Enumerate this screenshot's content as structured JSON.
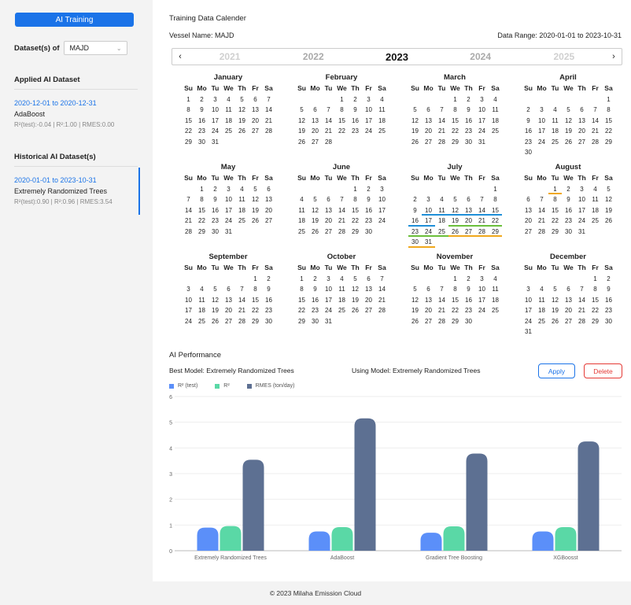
{
  "sidebar": {
    "ai_training_label": "AI Training",
    "dataset_label": "Dataset(s) of",
    "dataset_value": "MAJD",
    "applied_title": "Applied AI Dataset",
    "applied": {
      "range": "2020-12-01 to 2020-12-31",
      "model": "AdaBoost",
      "metrics": "R²(test):-0.04 | R²:1.00 | RMES:0.00"
    },
    "historical_title": "Historical AI Dataset(s)",
    "historical": {
      "range": "2020-01-01 to 2023-10-31",
      "model": "Extremely Randomized Trees",
      "metrics": "R²(test):0.90 | R²:0.96 | RMES:3.54"
    }
  },
  "main": {
    "title": "Training Data Calender",
    "vessel": "Vessel Name: MAJD",
    "data_range": "Data Range: 2020-01-01 to 2023-10-31"
  },
  "year_bar": {
    "prev": "‹",
    "next": "›",
    "years": [
      "2021",
      "2022",
      "2023",
      "2024",
      "2025"
    ],
    "active": "2023"
  },
  "weekday_labels": [
    "Su",
    "Mo",
    "Tu",
    "We",
    "Th",
    "Fr",
    "Sa"
  ],
  "calendar": [
    {
      "name": "January",
      "first": 0,
      "days": 31
    },
    {
      "name": "February",
      "first": 3,
      "days": 28
    },
    {
      "name": "March",
      "first": 3,
      "days": 31
    },
    {
      "name": "April",
      "first": 6,
      "days": 30
    },
    {
      "name": "May",
      "first": 1,
      "days": 31
    },
    {
      "name": "June",
      "first": 4,
      "days": 30
    },
    {
      "name": "July",
      "first": 6,
      "days": 31
    },
    {
      "name": "August",
      "first": 2,
      "days": 31
    },
    {
      "name": "September",
      "first": 5,
      "days": 30
    },
    {
      "name": "October",
      "first": 0,
      "days": 31
    },
    {
      "name": "November",
      "first": 3,
      "days": 30
    },
    {
      "name": "December",
      "first": 5,
      "days": 31
    }
  ],
  "highlights": {
    "July": {
      "10": "blue",
      "11": "blue",
      "12": "blue",
      "13": "blue",
      "14": "blue",
      "15": "blue",
      "16": "blue",
      "17": "blue",
      "19": "green",
      "20": "green",
      "21": "green",
      "22": "green",
      "23": "green",
      "24": "green",
      "25": "green",
      "26": "orange",
      "27": "orange",
      "28": "orange",
      "29": "orange",
      "30": "orange",
      "31": "orange"
    },
    "August": {
      "1": "orange"
    }
  },
  "highlight_colors": {
    "blue": "#1f8fd8",
    "green": "#6bbf3a",
    "orange": "#f0a81c"
  },
  "performance": {
    "title": "AI Performance",
    "best_model": "Best Model: Extremely Randomized Trees",
    "using_model": "Using Model: Extremely Randomized Trees",
    "apply_label": "Apply",
    "delete_label": "Delete"
  },
  "chart_data": {
    "type": "bar",
    "categories": [
      "Extremely Randomized Trees",
      "AdaBoost",
      "Gradient Tree Boosting",
      "XGBoosst"
    ],
    "series": [
      {
        "name": "R² (test)",
        "color": "#5b8ff9",
        "values": [
          0.9,
          0.75,
          0.7,
          0.75
        ]
      },
      {
        "name": "R²",
        "color": "#5ad8a6",
        "values": [
          0.96,
          0.92,
          0.95,
          0.92
        ]
      },
      {
        "name": "RMES (ton/day)",
        "color": "#5d7092",
        "values": [
          3.54,
          5.15,
          3.78,
          4.25
        ]
      }
    ],
    "yticks": [
      "0",
      "1",
      "2",
      "3",
      "4",
      "5",
      "6"
    ],
    "ylim": [
      0,
      6
    ],
    "grid": true,
    "legend": "top-left"
  },
  "footer": "© 2023 Milaha Emission Cloud"
}
